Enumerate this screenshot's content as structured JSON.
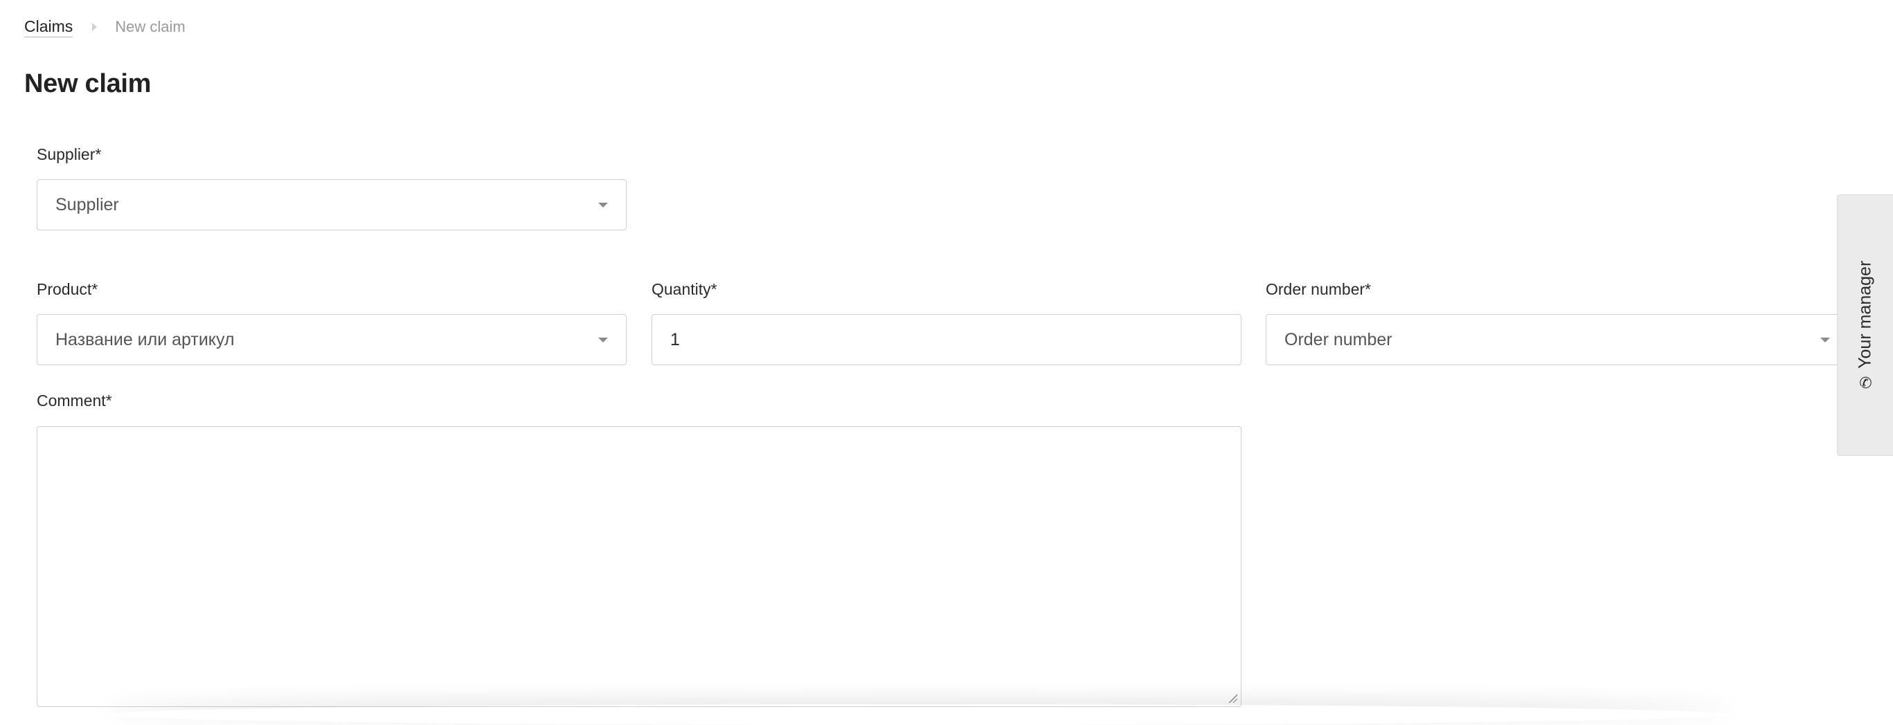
{
  "breadcrumb": {
    "parent": "Claims",
    "current": "New claim"
  },
  "page": {
    "title": "New claim"
  },
  "form": {
    "supplier": {
      "label": "Supplier*",
      "placeholder": "Supplier"
    },
    "product": {
      "label": "Product*",
      "placeholder": "Название или артикул"
    },
    "quantity": {
      "label": "Quantity*",
      "value": "1"
    },
    "order_number": {
      "label": "Order number*",
      "placeholder": "Order number"
    },
    "comment": {
      "label": "Comment*",
      "value": ""
    }
  },
  "manager_tab": {
    "label": "Your manager",
    "icon": "phone-icon"
  }
}
